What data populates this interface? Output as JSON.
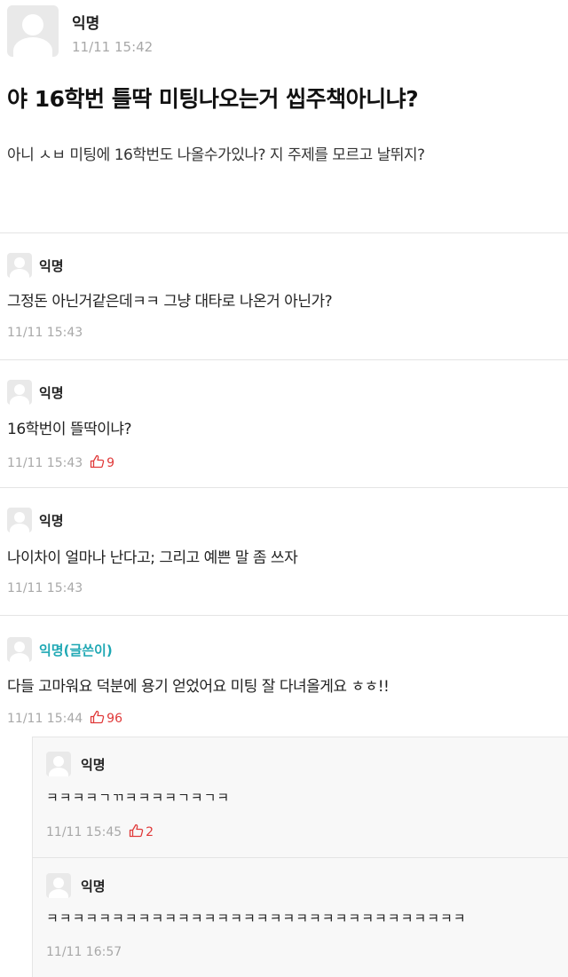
{
  "post": {
    "author": "익명",
    "time": "11/11 15:42",
    "title": "야 16학번 틀딱 미팅나오는거 씹주책아니냐?",
    "body": "아니 ㅅㅂ 미팅에 16학번도 나올수가있나? 지 주제를 모르고 날뛰지?"
  },
  "comments": [
    {
      "author": "익명",
      "text": "그정돈 아닌거같은데ㅋㅋ 그냥 대타로 나온거 아닌가?",
      "time": "11/11 15:43",
      "likes": ""
    },
    {
      "author": "익명",
      "text": "16학번이 뜰딱이냐?",
      "time": "11/11 15:43",
      "likes": "9"
    },
    {
      "author": "익명",
      "text": "나이차이 얼마나 난다고; 그리고 예쁜 말 좀 쓰자",
      "time": "11/11 15:43",
      "likes": ""
    },
    {
      "author": "익명(글쓴이)",
      "text": "다들 고마워요 덕분에 용기 얻었어요 미팅 잘 다녀올게요 ㅎㅎ!!",
      "time": "11/11 15:44",
      "likes": "96"
    }
  ],
  "replies": [
    {
      "author": "익명",
      "text": "ㅋㅋㅋㅋㄱㄲㅋㅋㅋㅋㄱㅋㄱㅋ",
      "time": "11/11 15:45",
      "likes": "2"
    },
    {
      "author": "익명",
      "text": "ㅋㅋㅋㅋㅋㅋㅋㅋㅋㅋㅋㅋㅋㅋㅋㅋㅋㅋㅋㅋㅋㅋㅋㅋㅋㅋㅋㅋㅋㅋㅋㅋ",
      "time": "11/11 16:57",
      "likes": ""
    }
  ],
  "colors": {
    "op_author": "#1fa8b4",
    "like": "#e03a3a",
    "meta": "#a8a8a8"
  },
  "icons": {
    "avatar": "default-profile-icon",
    "like": "thumbs-up-icon"
  }
}
